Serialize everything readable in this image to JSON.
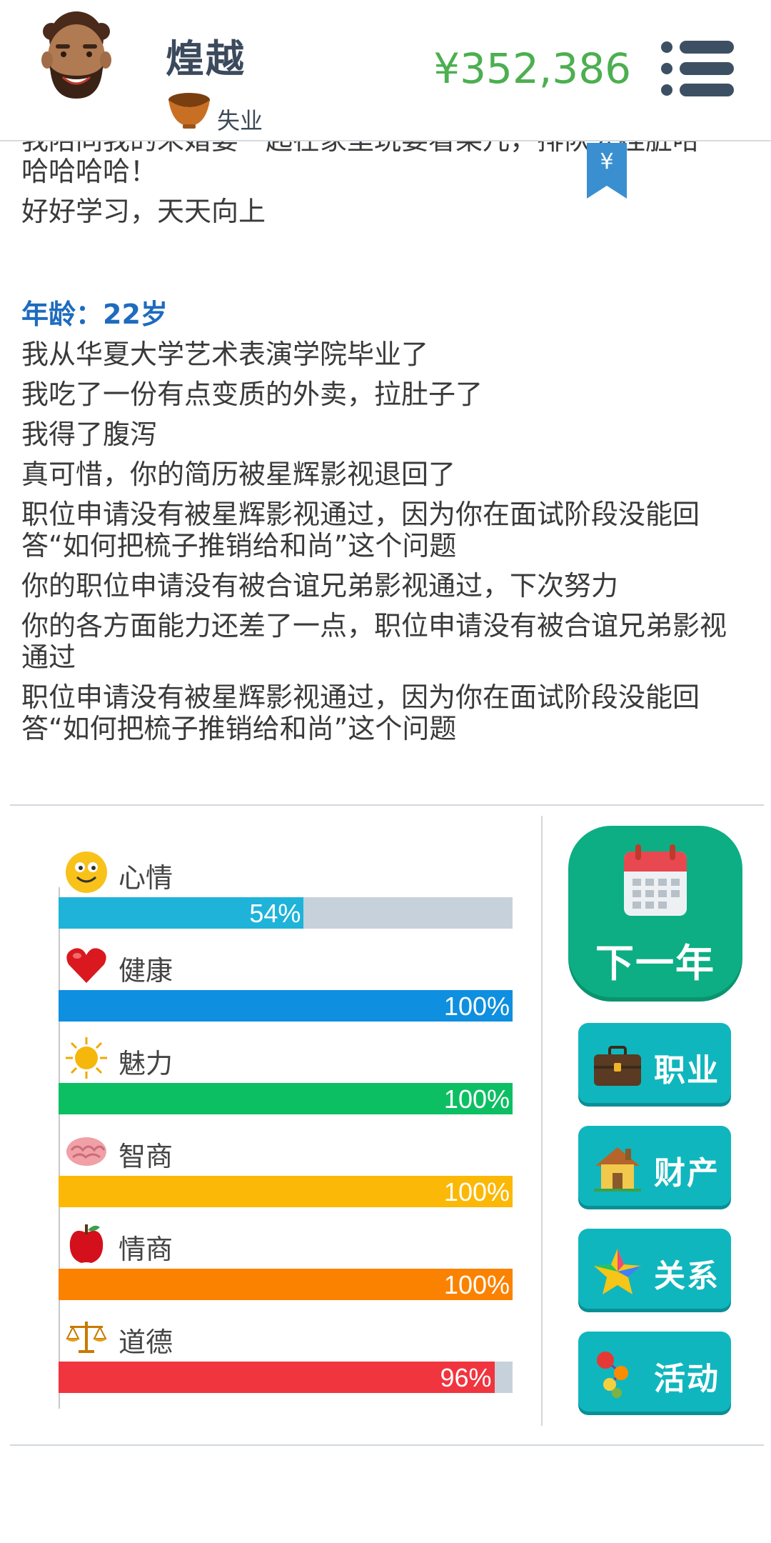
{
  "header": {
    "player_name": "煌越",
    "job_status": "失业",
    "money": "¥352,386",
    "avatar_icon": "bearded-man-avatar",
    "job_icon": "empty-bowl-icon",
    "menu_icon": "hamburger-menu-icon"
  },
  "bookmark": {
    "symbol": "¥",
    "icon": "yen-bookmark-icon"
  },
  "log": {
    "partial_lines": [
      "我陪同我的未婚妻一起在家里玩耍看某儿，排队去挂脏哈",
      "哈哈哈哈！",
      "好好学习，天天向上"
    ],
    "age_heading": "年龄：22岁",
    "events": [
      "我从华夏大学艺术表演学院毕业了",
      "我吃了一份有点变质的外卖，拉肚子了",
      "我得了腹泻",
      "真可惜，你的简历被星辉影视退回了",
      "职位申请没有被星辉影视通过，因为你在面试阶段没能回答“如何把梳子推销给和尚”这个问题",
      "你的职位申请没有被合谊兄弟影视通过，下次努力",
      "你的各方面能力还差了一点，职位申请没有被合谊兄弟影视通过",
      "职位申请没有被星辉影视通过，因为你在面试阶段没能回答“如何把梳子推销给和尚”这个问题"
    ]
  },
  "stats": [
    {
      "label": "心情",
      "value": 54,
      "display": "54%",
      "color": "#1fb3d9",
      "icon": "smiley-face-icon"
    },
    {
      "label": "健康",
      "value": 100,
      "display": "100%",
      "color": "#0f8fdf",
      "icon": "heart-icon"
    },
    {
      "label": "魅力",
      "value": 100,
      "display": "100%",
      "color": "#0dbf63",
      "icon": "sun-icon"
    },
    {
      "label": "智商",
      "value": 100,
      "display": "100%",
      "color": "#fbb806",
      "icon": "brain-icon"
    },
    {
      "label": "情商",
      "value": 100,
      "display": "100%",
      "color": "#fb8200",
      "icon": "apple-icon"
    },
    {
      "label": "道德",
      "value": 96,
      "display": "96%",
      "color": "#f0353f",
      "icon": "balance-scale-icon"
    }
  ],
  "buttons": {
    "next_year": "下一年",
    "career": "职业",
    "property": "财产",
    "relations": "关系",
    "activities": "活动"
  }
}
